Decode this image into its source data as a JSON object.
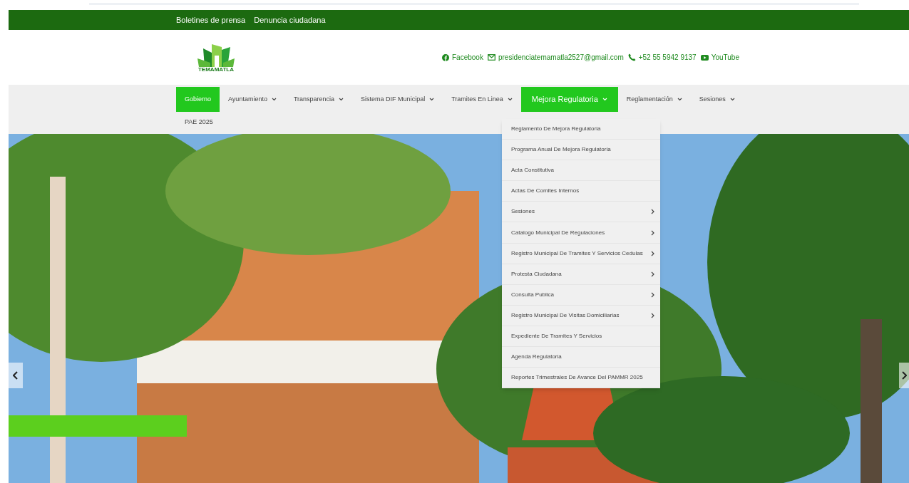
{
  "top_links": [
    "Boletines de prensa",
    "Denuncia ciudadana"
  ],
  "logo": {
    "text": "TEMAMATLA"
  },
  "contacts": [
    {
      "kind": "facebook",
      "text": "Facebook"
    },
    {
      "kind": "email",
      "text": "presidenciatemamatla2527@gmail.com"
    },
    {
      "kind": "phone",
      "text": "+52 55 5942 9137"
    },
    {
      "kind": "youtube",
      "text": "YouTube"
    }
  ],
  "nav": [
    {
      "label": "Gobierno",
      "selected": true,
      "expanded": false,
      "has_menu": false
    },
    {
      "label": "Ayuntamiento",
      "selected": false,
      "expanded": false,
      "has_menu": true
    },
    {
      "label": "Transparencia",
      "selected": false,
      "expanded": false,
      "has_menu": true
    },
    {
      "label": "Sistema DIF Municipal",
      "selected": false,
      "expanded": false,
      "has_menu": true
    },
    {
      "label": "Tramites En Linea",
      "selected": false,
      "expanded": false,
      "has_menu": true
    },
    {
      "label": "Mejora Regulatoria",
      "selected": true,
      "expanded": true,
      "has_menu": true
    },
    {
      "label": "Reglamentación",
      "selected": false,
      "expanded": false,
      "has_menu": true
    },
    {
      "label": "Sesiones",
      "selected": false,
      "expanded": false,
      "has_menu": true
    },
    {
      "label": "PAE 2025",
      "selected": false,
      "expanded": false,
      "has_menu": false
    }
  ],
  "dropdown": [
    {
      "label": "Reglamento De Mejora Regulatoria",
      "has_submenu": false
    },
    {
      "label": "Programa Anual De Mejora Regulatoria",
      "has_submenu": false
    },
    {
      "label": "Acta Constitutiva",
      "has_submenu": false
    },
    {
      "label": "Actas De Comites Internos",
      "has_submenu": false
    },
    {
      "label": "Sesiones",
      "has_submenu": true
    },
    {
      "label": "Catalogo Municipal De Regulaciones",
      "has_submenu": true
    },
    {
      "label": "Registro Municipal De Tramites Y Servicios Cedulas",
      "has_submenu": true
    },
    {
      "label": "Protesta Ciudadana",
      "has_submenu": true
    },
    {
      "label": "Consulta Publica",
      "has_submenu": true
    },
    {
      "label": "Registro Municipal De Visitas Domiciliarias",
      "has_submenu": true
    },
    {
      "label": "Expediente De Tramites Y Servicios",
      "has_submenu": false
    },
    {
      "label": "Agenda Regulatoria",
      "has_submenu": false
    },
    {
      "label": "Reportes Trimestrales De Avance Del PAMMR 2025",
      "has_submenu": false
    }
  ]
}
